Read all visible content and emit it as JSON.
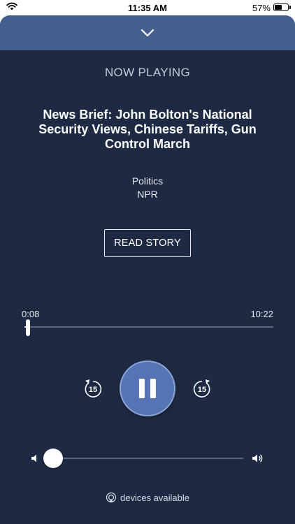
{
  "status_bar": {
    "time": "11:35 AM",
    "battery_percent": "57%",
    "battery_level": 0.57,
    "wifi_icon": "wifi-icon"
  },
  "header": {
    "collapse_icon": "chevron-down-icon"
  },
  "player": {
    "heading": "NOW PLAYING",
    "title": "News Brief: John Bolton's National Security Views, Chinese Tariffs, Gun Control March",
    "category": "Politics",
    "source": "NPR",
    "read_story_label": "READ STORY",
    "elapsed": "0:08",
    "duration": "10:22",
    "progress": 0.013,
    "skip_back_seconds": "15",
    "skip_forward_seconds": "15",
    "state": "playing",
    "volume": 0.05
  },
  "footer": {
    "devices_label": "devices available"
  },
  "colors": {
    "background": "#1e2a44",
    "header": "#45608f",
    "accent": "#5474b4"
  }
}
